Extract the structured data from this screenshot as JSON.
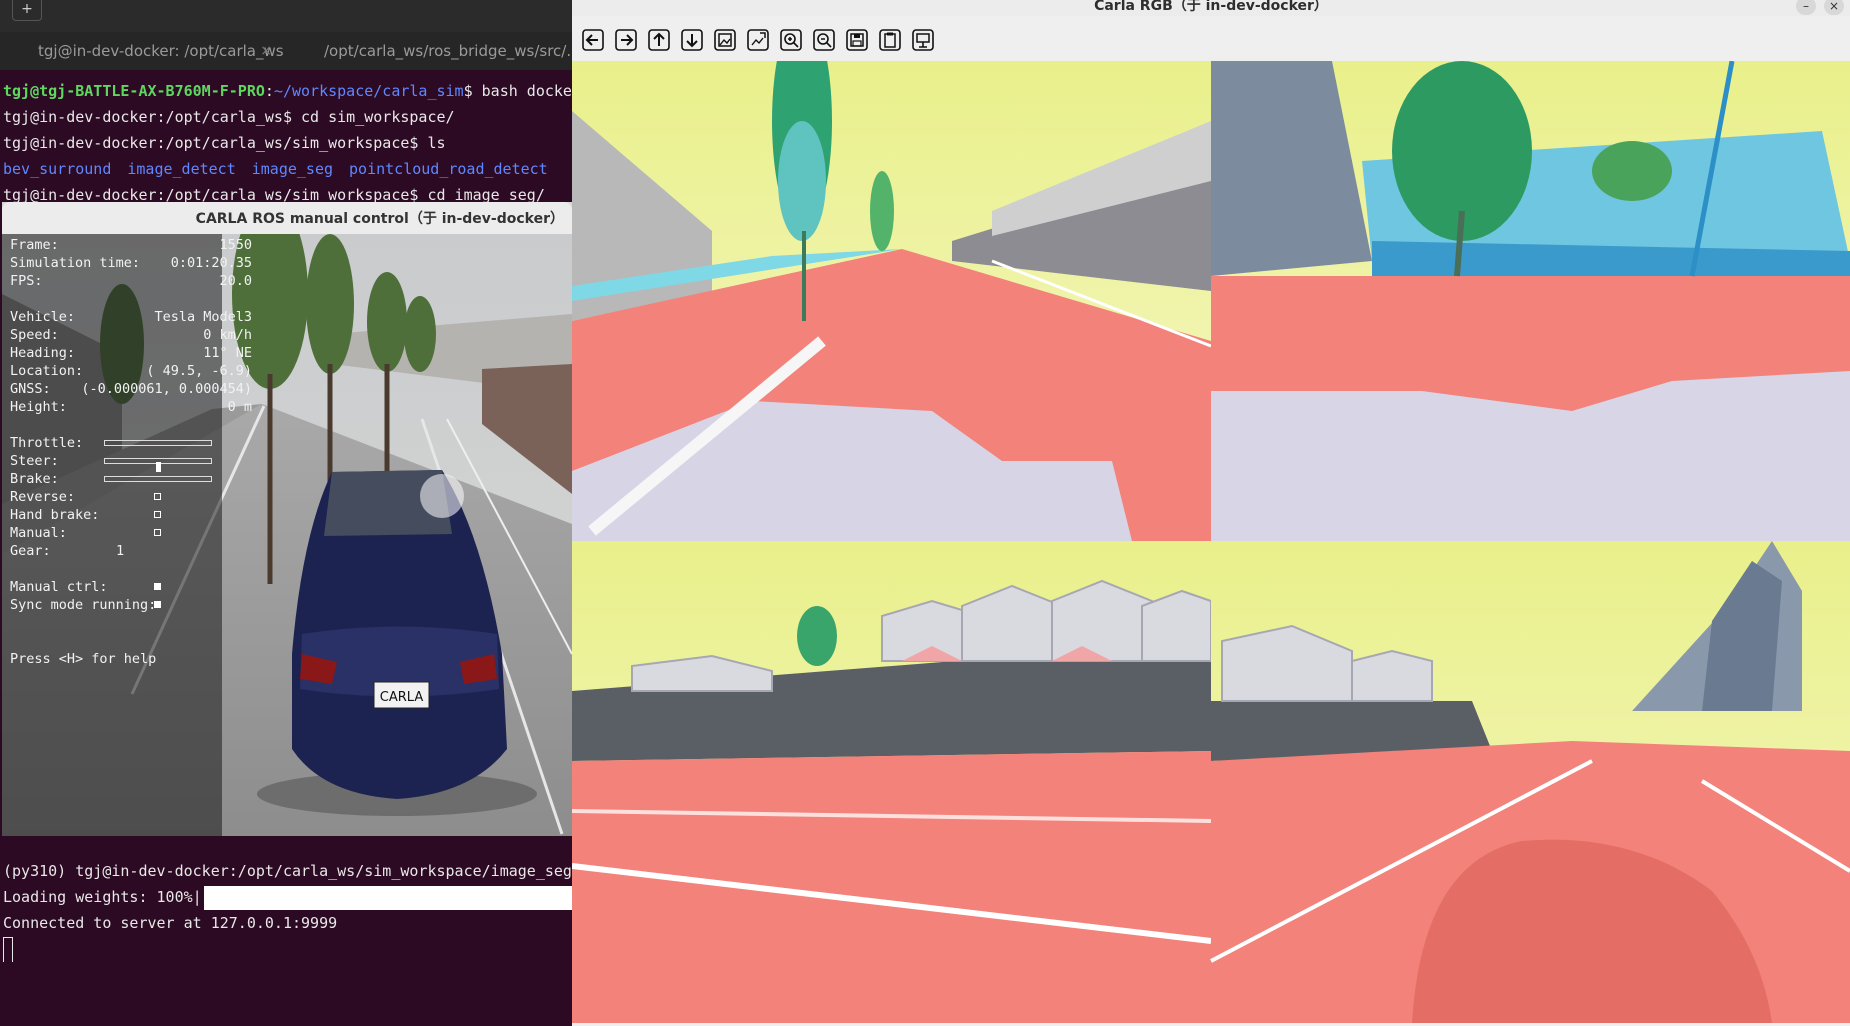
{
  "terminal": {
    "new_tab_icon": "new-tab-icon",
    "tabs": [
      {
        "label": "tgj@in-dev-docker: /opt/carla_ws",
        "close": "×"
      },
      {
        "label": "/opt/carla_ws/ros_bridge_ws/src/...",
        "close": ""
      }
    ],
    "lines": [
      {
        "user": "tgj@tgj-BATTLE-AX-B760M-F-PRO",
        "sep": ":",
        "path": "~/workspace/carla_sim",
        "cmd": "$ bash docke"
      },
      {
        "text": "tgj@in-dev-docker:/opt/carla_ws$ cd sim_workspace/"
      },
      {
        "text": "tgj@in-dev-docker:/opt/carla_ws/sim_workspace$ ls"
      },
      {
        "ls": [
          "bev_surround",
          "image_detect",
          "image_seg",
          "pointcloud_road_detect"
        ]
      },
      {
        "text": "tgj@in-dev-docker:/opt/carla_ws/sim_workspace$ cd image_seg/"
      }
    ],
    "bottom_lines": {
      "prompt": "(py310) tgj@in-dev-docker:/opt/carla_ws/sim_workspace/image_seg",
      "loading": "Loading weights: 100%|",
      "connected": "Connected to server at 127.0.0.1:9999"
    }
  },
  "manual_control": {
    "title": "CARLA ROS manual control（于 in-dev-docker）",
    "hud": {
      "frame": {
        "label": "Frame:",
        "value": "1550"
      },
      "sim_time": {
        "label": "Simulation time:",
        "value": "0:01:20.35"
      },
      "fps": {
        "label": "FPS:",
        "value": "20.0"
      },
      "vehicle": {
        "label": "Vehicle:",
        "value": "Tesla Model3"
      },
      "speed": {
        "label": "Speed:",
        "value": "0 km/h"
      },
      "heading": {
        "label": "Heading:",
        "value": "11° NE"
      },
      "location": {
        "label": "Location:",
        "value": "( 49.5,  -6.9)"
      },
      "gnss": {
        "label": "GNSS:",
        "value": "(-0.000061,  0.000454)"
      },
      "height": {
        "label": "Height:",
        "value": "0 m"
      },
      "throttle": {
        "label": "Throttle:",
        "fraction": 0.0
      },
      "steer": {
        "label": "Steer:",
        "fraction": 0.5
      },
      "brake": {
        "label": "Brake:",
        "fraction": 0.0
      },
      "reverse": {
        "label": "Reverse:",
        "checked": false
      },
      "hand_brake": {
        "label": "Hand brake:",
        "checked": false
      },
      "manual": {
        "label": "Manual:",
        "checked": false
      },
      "gear": {
        "label": "Gear:",
        "value": "1"
      },
      "manual_ctrl": {
        "label": "Manual ctrl:",
        "checked": true
      },
      "sync_mode": {
        "label": "Sync mode running:",
        "checked": true
      },
      "help": "Press <H> for help"
    },
    "license_plate": "CARLA"
  },
  "viewer": {
    "title": "Carla RGB（于 in-dev-docker）",
    "window_controls": {
      "minimize": "–",
      "close": "×"
    },
    "toolbar": [
      {
        "name": "back-arrow-icon"
      },
      {
        "name": "forward-arrow-icon"
      },
      {
        "name": "up-arrow-icon"
      },
      {
        "name": "down-arrow-icon"
      },
      {
        "name": "fit-image-icon"
      },
      {
        "name": "actual-size-icon"
      },
      {
        "name": "zoom-in-icon"
      },
      {
        "name": "zoom-out-icon"
      },
      {
        "name": "save-icon"
      },
      {
        "name": "clipboard-icon"
      },
      {
        "name": "settings-icon"
      }
    ],
    "panels": [
      "camera-front",
      "camera-right",
      "camera-left",
      "camera-rear"
    ]
  }
}
